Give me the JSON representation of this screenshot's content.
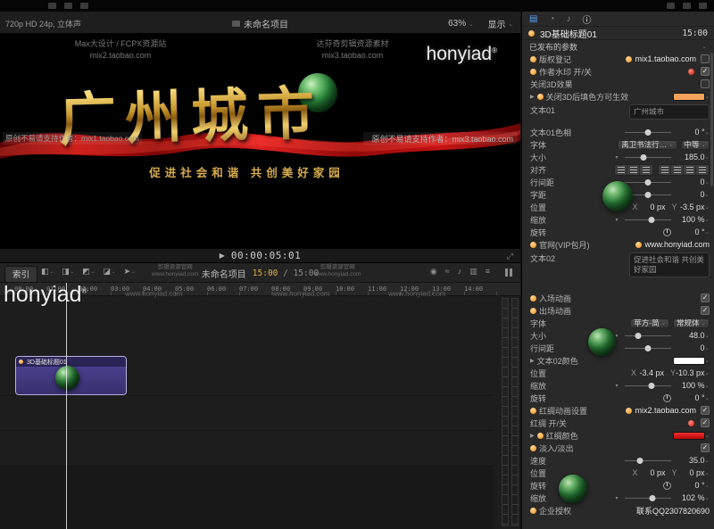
{
  "icons": {
    "play": "▶",
    "fullscreen": "⤢",
    "chevron_down": "⌄",
    "dropdown": "▾",
    "disclosure": "▶",
    "check": "✓",
    "registered": "®",
    "connect_clip": "◧",
    "insert_clip": "◨",
    "append_clip": "◩",
    "overwrite_clip": "◪",
    "select_tool": "➤",
    "skimming": "◉",
    "audio_skimming": "≈",
    "solo": "♪",
    "snapping": "▥",
    "clip_appearance": "≡",
    "video_tab": "▤",
    "color_tab": "◔",
    "audio_tab": "♪",
    "info_tab": "ⓘ"
  },
  "labels": {
    "x": "X",
    "y": "Y"
  },
  "colors": {
    "accent_orange": "#f0941d",
    "timecode_yellow": "#e0b23c",
    "fill_swatch": "#f2a35c",
    "text02_swatch": "#ffffff",
    "ribbon_swatch": "#d60f0f",
    "clip_fill": "#463d8f",
    "title_gold": "#e8c55a",
    "sphere_green": "#1d7a30",
    "ribbon_red": "#c41010"
  },
  "header": {
    "format_info": "720p HD 24p, 立体声",
    "project_title": "未命名项目",
    "zoom_level": "63%",
    "view_menu": "显示"
  },
  "viewer": {
    "watermark1_line1": "Max大设计 / FCPX资源站",
    "watermark1_line2": "mix2.taobao.com",
    "watermark2_line1": "达芬奇剪辑资源素材",
    "watermark2_line2": "mix3.taobao.com",
    "brand": "honyiad",
    "title": "广州城市",
    "subtitle": "促进社会和谐 共创美好家园",
    "credit_left": "原创不易请支持作者：mix1.taobao.com",
    "credit_right": "原创不易请支持作者：mix3.taobao.com",
    "timecode": "00:00:05:01"
  },
  "timeline": {
    "index_button": "索引",
    "project_name": "未命名项目",
    "duration_current": "15:00",
    "duration_total": "/ 15:00",
    "watermark_brand": "honyiad",
    "watermark_site": "www.honyiad.com",
    "watermark_label": "剪辑资源官网",
    "clip_label": "3D基础标题01",
    "ruler": [
      "00:00",
      "01:00",
      "02:00",
      "03:00",
      "04:00",
      "05:00",
      "06:00",
      "07:00",
      "08:00",
      "09:00",
      "10:00",
      "11:00",
      "12:00",
      "13:00",
      "14:00"
    ]
  },
  "inspector": {
    "title": "3D基础标题01",
    "duration": "15:00",
    "section": "已发布的参数",
    "rows": {
      "copyright": {
        "label": "版权登记",
        "value": "mix1.taobao.com"
      },
      "author_watermark": {
        "label": "作者水印 开/关"
      },
      "disable_3d": {
        "label": "关闭3D效果"
      },
      "fill_color": {
        "label": "关闭3D后填色方可生效"
      },
      "text01": {
        "label": "文本01",
        "value": "广州城市"
      },
      "text01_hue": {
        "label": "文本01色相",
        "value": "0 °"
      },
      "font01": {
        "label": "字体",
        "family": "禹卫书法行…",
        "style": "中等"
      },
      "size01": {
        "label": "大小",
        "value": "185.0"
      },
      "align": {
        "label": "对齐"
      },
      "line_spacing01": {
        "label": "行间距",
        "value": "0"
      },
      "tracking01": {
        "label": "字距",
        "value": "0"
      },
      "position01": {
        "label": "位置",
        "x": "0 px",
        "y": "-3.5 px"
      },
      "scale01": {
        "label": "缩放",
        "value": "100 %"
      },
      "rotation01": {
        "label": "旋转",
        "value": "0 °"
      },
      "website": {
        "label": "官网(VIP包月)",
        "value": "www.honyiad.com"
      },
      "text02": {
        "label": "文本02",
        "value": "促进社会和谐 共创美好家园"
      },
      "anim_in": {
        "label": "入场动画"
      },
      "anim_out": {
        "label": "出场动画"
      },
      "font02": {
        "label": "字体",
        "family": "苹方-简",
        "style": "常规体"
      },
      "size02": {
        "label": "大小",
        "value": "48.0"
      },
      "line_spacing02": {
        "label": "行间距",
        "value": "0"
      },
      "text02_color": {
        "label": "文本02颜色"
      },
      "position02": {
        "label": "位置",
        "x": "-3.4 px",
        "y": "-10.3 px"
      },
      "scale02": {
        "label": "缩放",
        "value": "100 %"
      },
      "rotation02": {
        "label": "旋转",
        "value": "0 °"
      },
      "ribbon_anim": {
        "label": "红绸动画设置",
        "value": "mix2.taobao.com"
      },
      "ribbon_switch": {
        "label": "红绸 开/关"
      },
      "ribbon_color": {
        "label": "红绸颜色"
      },
      "fade": {
        "label": "淡入/淡出"
      },
      "speed": {
        "label": "速度",
        "value": "35.0"
      },
      "position03": {
        "label": "位置",
        "x": "0 px",
        "y": "0 px"
      },
      "rotation03": {
        "label": "旋转",
        "value": "0 °"
      },
      "scale03": {
        "label": "缩放",
        "value": "102 %"
      },
      "license": {
        "label": "企业授权",
        "value": "联系QQ2307820690"
      }
    }
  }
}
